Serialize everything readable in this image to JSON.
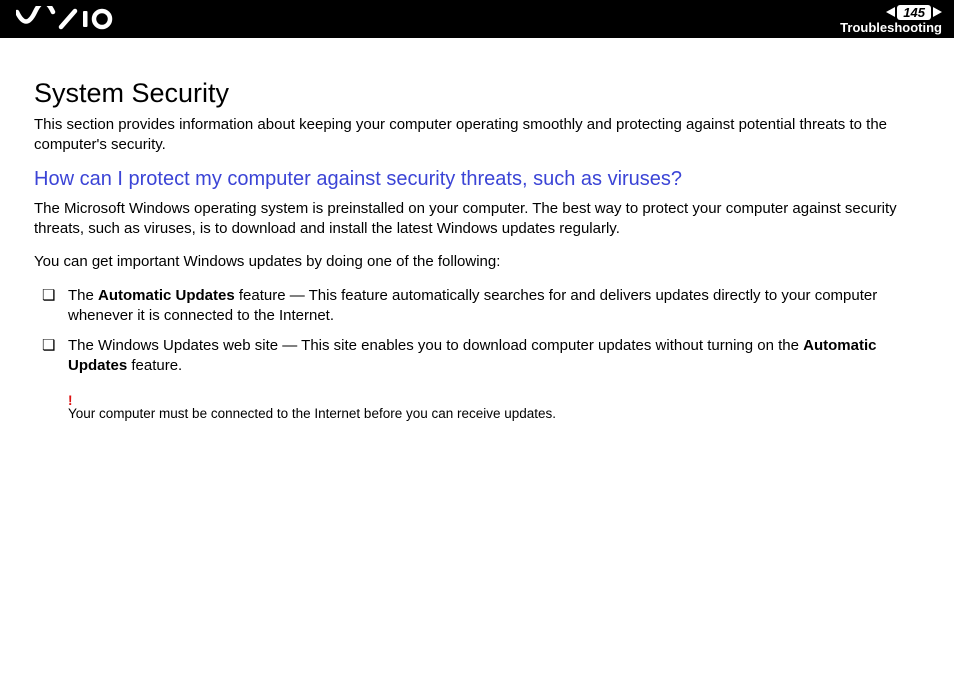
{
  "header": {
    "page_number": "145",
    "section": "Troubleshooting"
  },
  "body": {
    "title": "System Security",
    "intro": "This section provides information about keeping your computer operating smoothly and protecting against potential threats to the computer's security.",
    "question": "How can I protect my computer against security threats, such as viruses?",
    "answer1": "The Microsoft Windows operating system is preinstalled on your computer. The best way to protect your computer against security threats, such as viruses, is to download and install the latest Windows updates regularly.",
    "answer2": "You can get important Windows updates by doing one of the following:",
    "bullets": [
      {
        "pre": "The ",
        "bold1": "Automatic Updates",
        "post": " feature — This feature automatically searches for and delivers updates directly to your computer whenever it is connected to the Internet."
      },
      {
        "pre": "The Windows Updates web site — This site enables you to download computer updates without turning on the ",
        "bold1": "Automatic Updates",
        "post": " feature."
      }
    ],
    "note_mark": "!",
    "note": "Your computer must be connected to the Internet before you can receive updates."
  }
}
